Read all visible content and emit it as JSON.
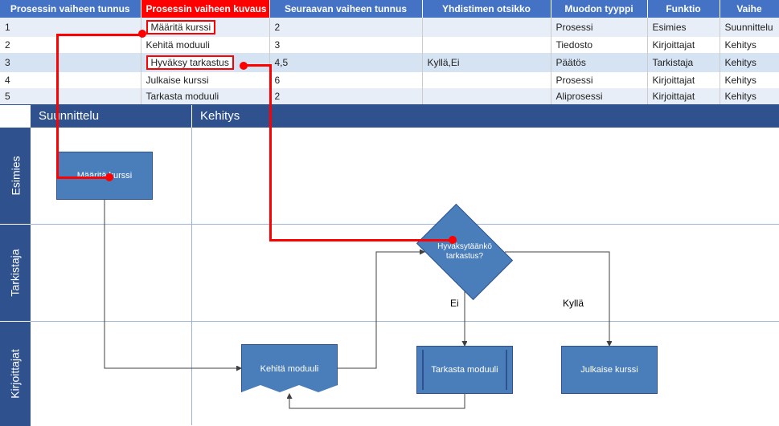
{
  "table": {
    "headers": {
      "id": "Prosessin vaiheen tunnus",
      "desc": "Prosessin vaiheen kuvaus",
      "next": "Seuraavan vaiheen tunnus",
      "conn": "Yhdistimen otsikko",
      "shape": "Muodon tyyppi",
      "func": "Funktio",
      "phase": "Vaihe"
    },
    "rows": [
      {
        "id": "1",
        "desc": "Määritä kurssi",
        "next": "2",
        "conn": "",
        "shape": "Prosessi",
        "func": "Esimies",
        "phase": "Suunnittelu"
      },
      {
        "id": "2",
        "desc": "Kehitä moduuli",
        "next": "3",
        "conn": "",
        "shape": "Tiedosto",
        "func": "Kirjoittajat",
        "phase": "Kehitys"
      },
      {
        "id": "3",
        "desc": "Hyväksy tarkastus",
        "next": "4,5",
        "conn": "Kyllä,Ei",
        "shape": "Päätös",
        "func": "Tarkistaja",
        "phase": "Kehitys"
      },
      {
        "id": "4",
        "desc": "Julkaise kurssi",
        "next": "6",
        "conn": "",
        "shape": "Prosessi",
        "func": "Kirjoittajat",
        "phase": "Kehitys"
      },
      {
        "id": "5",
        "desc": "Tarkasta moduuli",
        "next": "2",
        "conn": "",
        "shape": "Aliprosessi",
        "func": "Kirjoittajat",
        "phase": "Kehitys"
      }
    ]
  },
  "phases": {
    "p1": "Suunnittelu",
    "p2": "Kehitys"
  },
  "lanes": {
    "l1": "Esimies",
    "l2": "Tarkistaja",
    "l3": "Kirjoittajat"
  },
  "shapes": {
    "s1": "Määritä kurssi",
    "s2": "Kehitä moduuli",
    "s3": "Hyväksytäänkö tarkastus?",
    "s4": "Julkaise kurssi",
    "s5": "Tarkasta moduuli"
  },
  "connectors": {
    "no": "Ei",
    "yes": "Kyllä"
  },
  "colors": {
    "accent": "#4472C4",
    "shape": "#4A7EBB",
    "highlight": "#FF0000",
    "dark": "#2F528F"
  }
}
